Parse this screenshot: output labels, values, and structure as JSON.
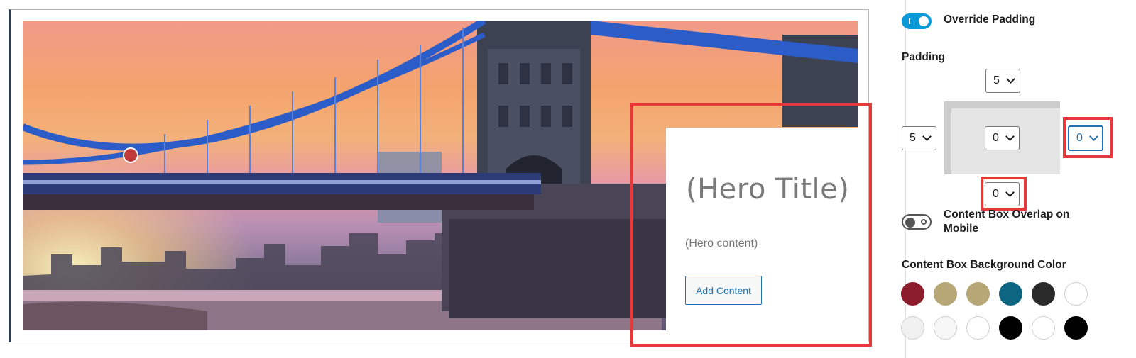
{
  "hero": {
    "title": "(Hero Title)",
    "content": "(Hero content)",
    "add_content_label": "Add Content"
  },
  "sidebar": {
    "override_padding": {
      "label": "Override Padding",
      "enabled": true
    },
    "padding": {
      "label": "Padding",
      "top": "5",
      "left": "5",
      "center": "0",
      "right": "0",
      "bottom": "0"
    },
    "overlap_mobile": {
      "label": "Content Box Overlap on Mobile",
      "enabled": false
    },
    "bg_color": {
      "label": "Content Box Background Color",
      "swatches": [
        "#8b1c2c",
        "#b7a676",
        "#b7a676",
        "#0c6682",
        "#2a2a2a",
        "#ffffff",
        "#f0f0f0",
        "#f7f7f7",
        "#ffffff",
        "#000000",
        "#ffffff",
        "#000000"
      ]
    }
  },
  "colors": {
    "accent": "#2271b1",
    "toggle_on": "#0a9ad8",
    "highlight": "#e63a3a"
  }
}
